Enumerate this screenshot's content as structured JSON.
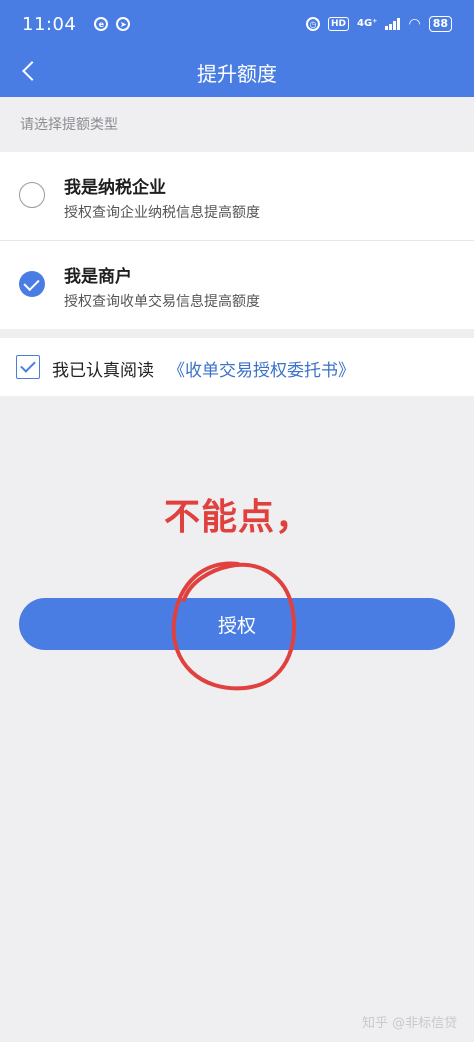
{
  "status_bar": {
    "time": "11:04",
    "hd_badge": "HD",
    "network": "4G⁺",
    "battery": "88"
  },
  "header": {
    "title": "提升额度"
  },
  "section_hint": "请选择提额类型",
  "options": [
    {
      "title": "我是纳税企业",
      "desc": "授权查询企业纳税信息提高额度",
      "selected": false
    },
    {
      "title": "我是商户",
      "desc": "授权查询收单交易信息提高额度",
      "selected": true
    }
  ],
  "agreement": {
    "checked": true,
    "text": "我已认真阅读",
    "link": "《收单交易授权委托书》"
  },
  "annotation": "不能点，",
  "auth_button_label": "授权",
  "watermark": "知乎 @非标信贷",
  "colors": {
    "brand_blue": "#4a7de4",
    "annotation_red": "#e0403e"
  }
}
